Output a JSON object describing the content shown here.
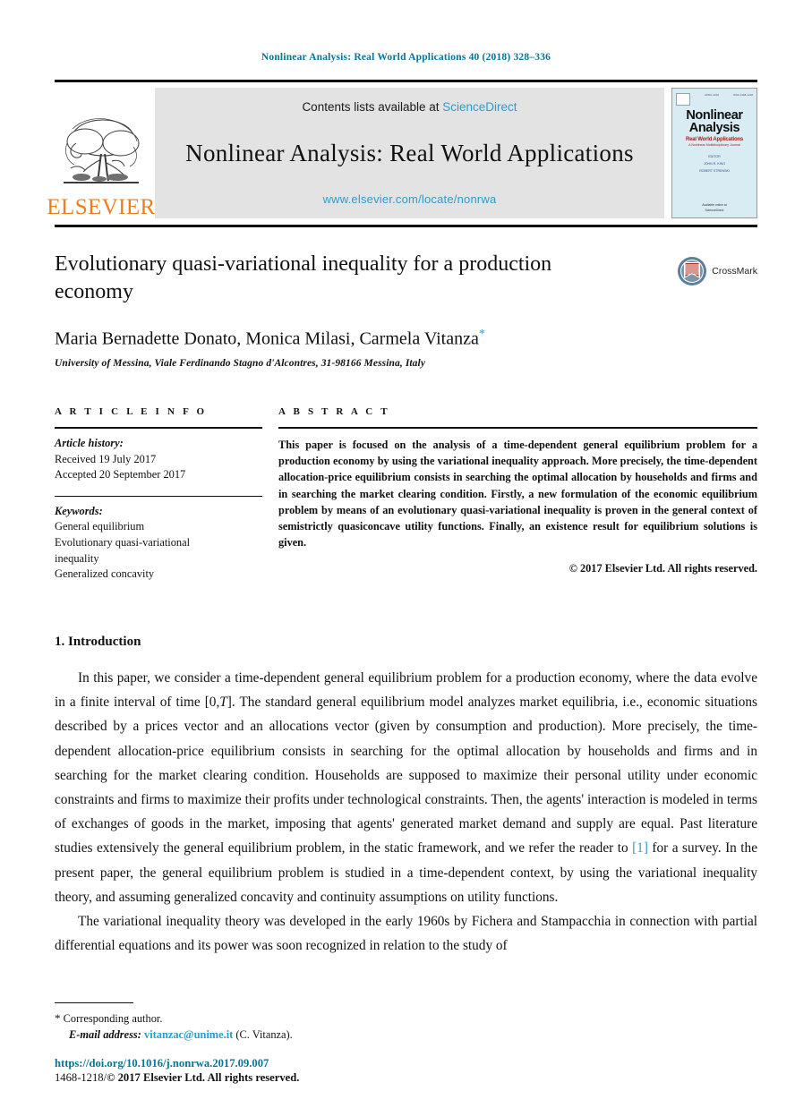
{
  "running_head": "Nonlinear Analysis: Real World Applications 40 (2018) 328–336",
  "masthead": {
    "publisher_name": "ELSEVIER",
    "contents_prefix": "Contents lists available at ",
    "sciencedirect": "ScienceDirect",
    "journal_title": "Nonlinear Analysis: Real World Applications",
    "journal_url": "www.elsevier.com/locate/nonrwa",
    "cover": {
      "title_line1": "Nonlinear",
      "title_line2": "Analysis",
      "subtitle": "Real World Applications",
      "subtitle2": "A Nonlinear Multidisciplinary Journal",
      "editor_label": "EDITOR",
      "editor_name": "JOHN R. KING",
      "editor_name2": "ROBERT STRENSKI",
      "bottom_line1": "Available online at",
      "bottom_line2": "ScienceDirect"
    },
    "cover_top_left": "VOLUME 40",
    "cover_top_mid": "APRIL 2018",
    "cover_top_right": "ISSN 1468-1218"
  },
  "article": {
    "title": "Evolutionary quasi-variational inequality for a production economy",
    "crossmark_label": "CrossMark",
    "authors": "Maria Bernadette Donato, Monica Milasi, Carmela Vitanza",
    "author_star": "*",
    "affiliation": "University of Messina, Viale Ferdinando Stagno d'Alcontres, 31-98166 Messina, Italy"
  },
  "article_info": {
    "heading": "A R T I C L E   I N F O",
    "history_label": "Article history:",
    "received": "Received 19 July 2017",
    "accepted": "Accepted 20 September 2017",
    "keywords_label": "Keywords:",
    "keywords": [
      "General equilibrium",
      "Evolutionary quasi-variational",
      "inequality",
      "Generalized concavity"
    ]
  },
  "abstract": {
    "heading": "A B S T R A C T",
    "text": "This paper is focused on the analysis of a time-dependent general equilibrium problem for a production economy by using the variational inequality approach. More precisely, the time-dependent allocation-price equilibrium consists in searching the optimal allocation by households and firms and in searching the market clearing condition. Firstly, a new formulation of the economic equilibrium problem by means of an evolutionary quasi-variational inequality is proven in the general context of semistrictly quasiconcave utility functions. Finally, an existence result for equilibrium solutions is given.",
    "copyright": "© 2017 Elsevier Ltd. All rights reserved."
  },
  "body": {
    "section_number_title": "1. Introduction",
    "paragraph1_part1": "In this paper, we consider a time-dependent general equilibrium problem for a production economy, where the data evolve in a finite interval of time [0,",
    "paragraph1_T": "T",
    "paragraph1_part2": "]. The standard general equilibrium model analyzes market equilibria, i.e., economic situations described by a prices vector and an allocations vector (given by consumption and production). More precisely, the time-dependent allocation-price equilibrium consists in searching for the optimal allocation by households and firms and in searching for the market clearing condition. Households are supposed to maximize their personal utility under economic constraints and firms to maximize their profits under technological constraints. Then, the agents' interaction is modeled in terms of exchanges of goods in the market, imposing that agents' generated market demand and supply are equal. Past literature studies extensively the general equilibrium problem, in the static framework, and we refer the reader to ",
    "paragraph1_ref": "[1]",
    "paragraph1_part3": " for a survey. In the present paper, the general equilibrium problem is studied in a time-dependent context, by using the variational inequality theory, and assuming generalized concavity and continuity assumptions on utility functions.",
    "paragraph2": "The variational inequality theory was developed in the early 1960s by Fichera and Stampacchia in connection with partial differential equations and its power was soon recognized in relation to the study of"
  },
  "footer": {
    "corresponding_star": "*",
    "corresponding_author": "Corresponding author.",
    "email_label": "E-mail address:",
    "email": "vitanzac@unime.it",
    "email_owner": "(C. Vitanza).",
    "doi": "https://doi.org/10.1016/j.nonrwa.2017.09.007",
    "issn_prefix": "1468-1218/",
    "issn_copyright": "© 2017 Elsevier Ltd. All rights reserved."
  },
  "colors": {
    "link": "#2e9ccc",
    "running_head": "#0b7396",
    "elsevier_orange": "#ef7d1a",
    "cover_bg": "#d9ecf4",
    "banner_bg": "#e3e3e3"
  }
}
